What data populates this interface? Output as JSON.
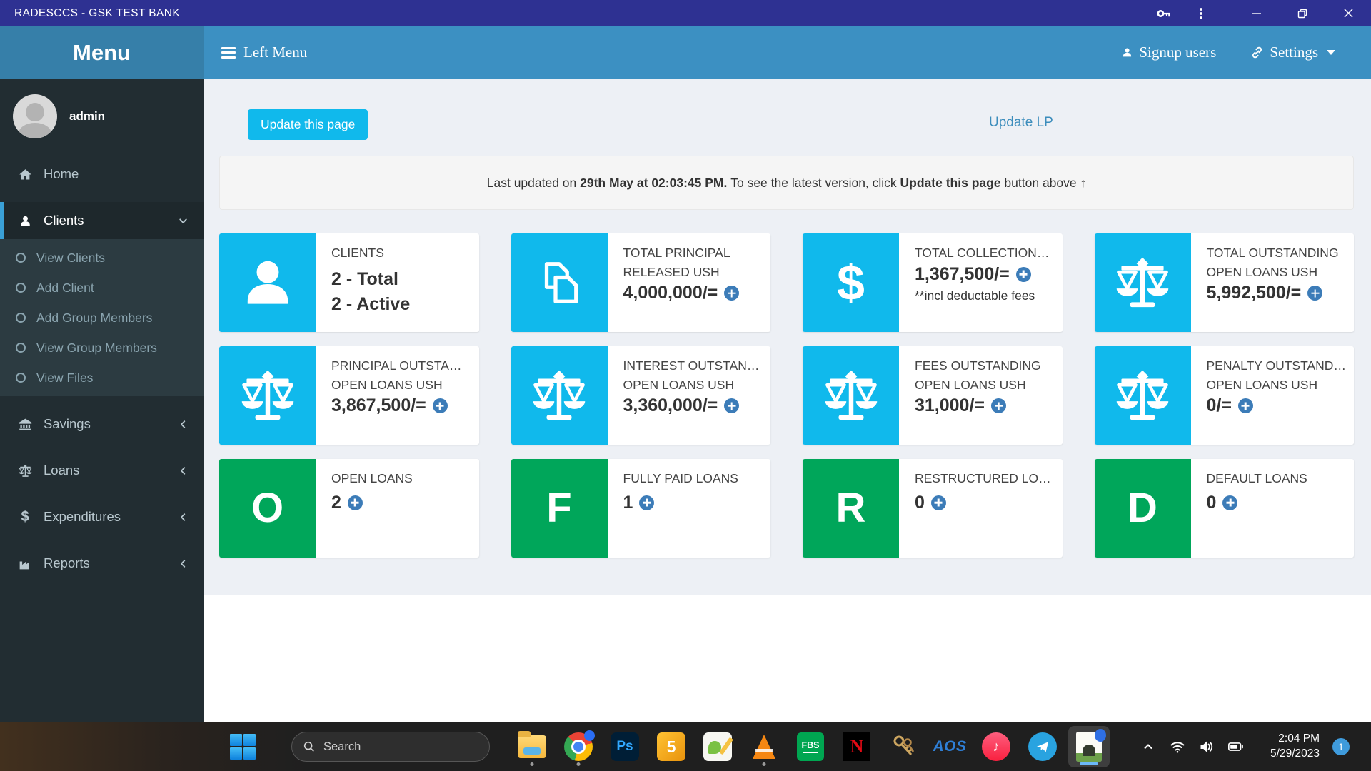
{
  "window": {
    "title": "RADESCCS - GSK TEST BANK"
  },
  "navbar": {
    "brand": "Menu",
    "left_menu": "Left Menu",
    "signup_users": "Signup users",
    "settings": "Settings"
  },
  "sidebar": {
    "user": "admin",
    "home": "Home",
    "clients": "Clients",
    "clients_submenu": [
      "View Clients",
      "Add Client",
      "Add Group Members",
      "View Group Members",
      "View Files"
    ],
    "savings": "Savings",
    "loans": "Loans",
    "expenditures": "Expenditures",
    "reports": "Reports"
  },
  "page": {
    "update_button": "Update this page",
    "update_lp": "Update LP",
    "alert_prefix": "Last updated on ",
    "alert_bold_time": "29th May at 02:03:45 PM.",
    "alert_mid": " To see the latest version, click ",
    "alert_bold_action": "Update this page",
    "alert_suffix": " button above ↑"
  },
  "glyphs": {
    "dollar": "$",
    "music_note": "♪"
  },
  "cards": [
    {
      "title": "CLIENTS",
      "value": "2 - Total",
      "value2": "2 - Active",
      "icon": "user-icon",
      "color": "cyan"
    },
    {
      "title": "TOTAL PRINCIPAL",
      "title2": "RELEASED USH",
      "value": "4,000,000/=",
      "icon": "copy-icon",
      "color": "cyan"
    },
    {
      "title": "TOTAL COLLECTION…",
      "value": "1,367,500/=",
      "note": "**incl deductable fees",
      "icon": "dollar-icon",
      "color": "cyan"
    },
    {
      "title": "TOTAL OUTSTANDING",
      "title2": "OPEN LOANS USH",
      "value": "5,992,500/=",
      "icon": "scales-icon",
      "color": "cyan"
    },
    {
      "title": "PRINCIPAL OUTSTA…",
      "title2": "OPEN LOANS USH",
      "value": "3,867,500/=",
      "icon": "scales-icon",
      "color": "cyan"
    },
    {
      "title": "INTEREST OUTSTAN…",
      "title2": "OPEN LOANS USH",
      "value": "3,360,000/=",
      "icon": "scales-icon",
      "color": "cyan"
    },
    {
      "title": "FEES OUTSTANDING",
      "title2": "OPEN LOANS USH",
      "value": "31,000/=",
      "icon": "scales-icon",
      "color": "cyan"
    },
    {
      "title": "PENALTY OUTSTAND…",
      "title2": "OPEN LOANS USH",
      "value": "0/=",
      "icon": "scales-icon",
      "color": "cyan"
    },
    {
      "title": "OPEN LOANS",
      "value": "2",
      "letter": "O",
      "color": "green"
    },
    {
      "title": "FULLY PAID LOANS",
      "value": "1",
      "letter": "F",
      "color": "green"
    },
    {
      "title": "RESTRUCTURED LO…",
      "value": "0",
      "letter": "R",
      "color": "green"
    },
    {
      "title": "DEFAULT LOANS",
      "value": "0",
      "letter": "D",
      "color": "green"
    }
  ],
  "taskbar": {
    "search_placeholder": "Search",
    "labels": {
      "photoshop": "Ps",
      "five": "5",
      "fbs": "FBS",
      "netflix": "N",
      "aos": "AOS"
    },
    "icons": [
      "start",
      "search",
      "file-explorer",
      "chrome",
      "photoshop",
      "five-book",
      "notepad-plus-plus",
      "vlc-cone",
      "fbs",
      "netflix",
      "keys",
      "aos",
      "music",
      "telegram",
      "active-image-app"
    ],
    "tray_icons": [
      "chevron-up",
      "wifi",
      "volume",
      "battery"
    ],
    "clock": {
      "time": "2:04 PM",
      "date": "5/29/2023"
    },
    "badge": "1"
  },
  "colors": {
    "cyan": "#10b9ec",
    "green": "#00a65a",
    "navbar": "#3c90c2",
    "titlebar": "#2e3192",
    "link": "#3c8dbc"
  }
}
